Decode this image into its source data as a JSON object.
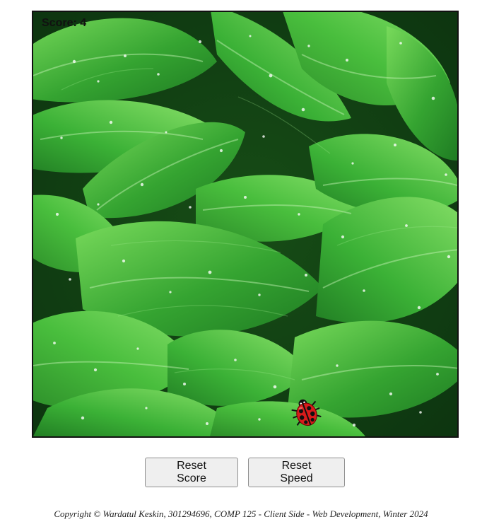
{
  "game": {
    "score_label": "Score: 4",
    "background_scene": "green-hosta-leaves-with-water-drops",
    "bug_icon": "ladybug-icon"
  },
  "controls": {
    "reset_score_label": "Reset Score",
    "reset_speed_label": "Reset Speed"
  },
  "footer": {
    "copyright": "Copyright © Wardatul Keskin, 301294696, COMP 125 - Client Side - Web Development, Winter 2024"
  },
  "colors": {
    "leaf_light": "#6ad14f",
    "leaf_mid": "#2f9a2a",
    "leaf_dark": "#0f4d14",
    "ladybug_red": "#d81b1b"
  }
}
